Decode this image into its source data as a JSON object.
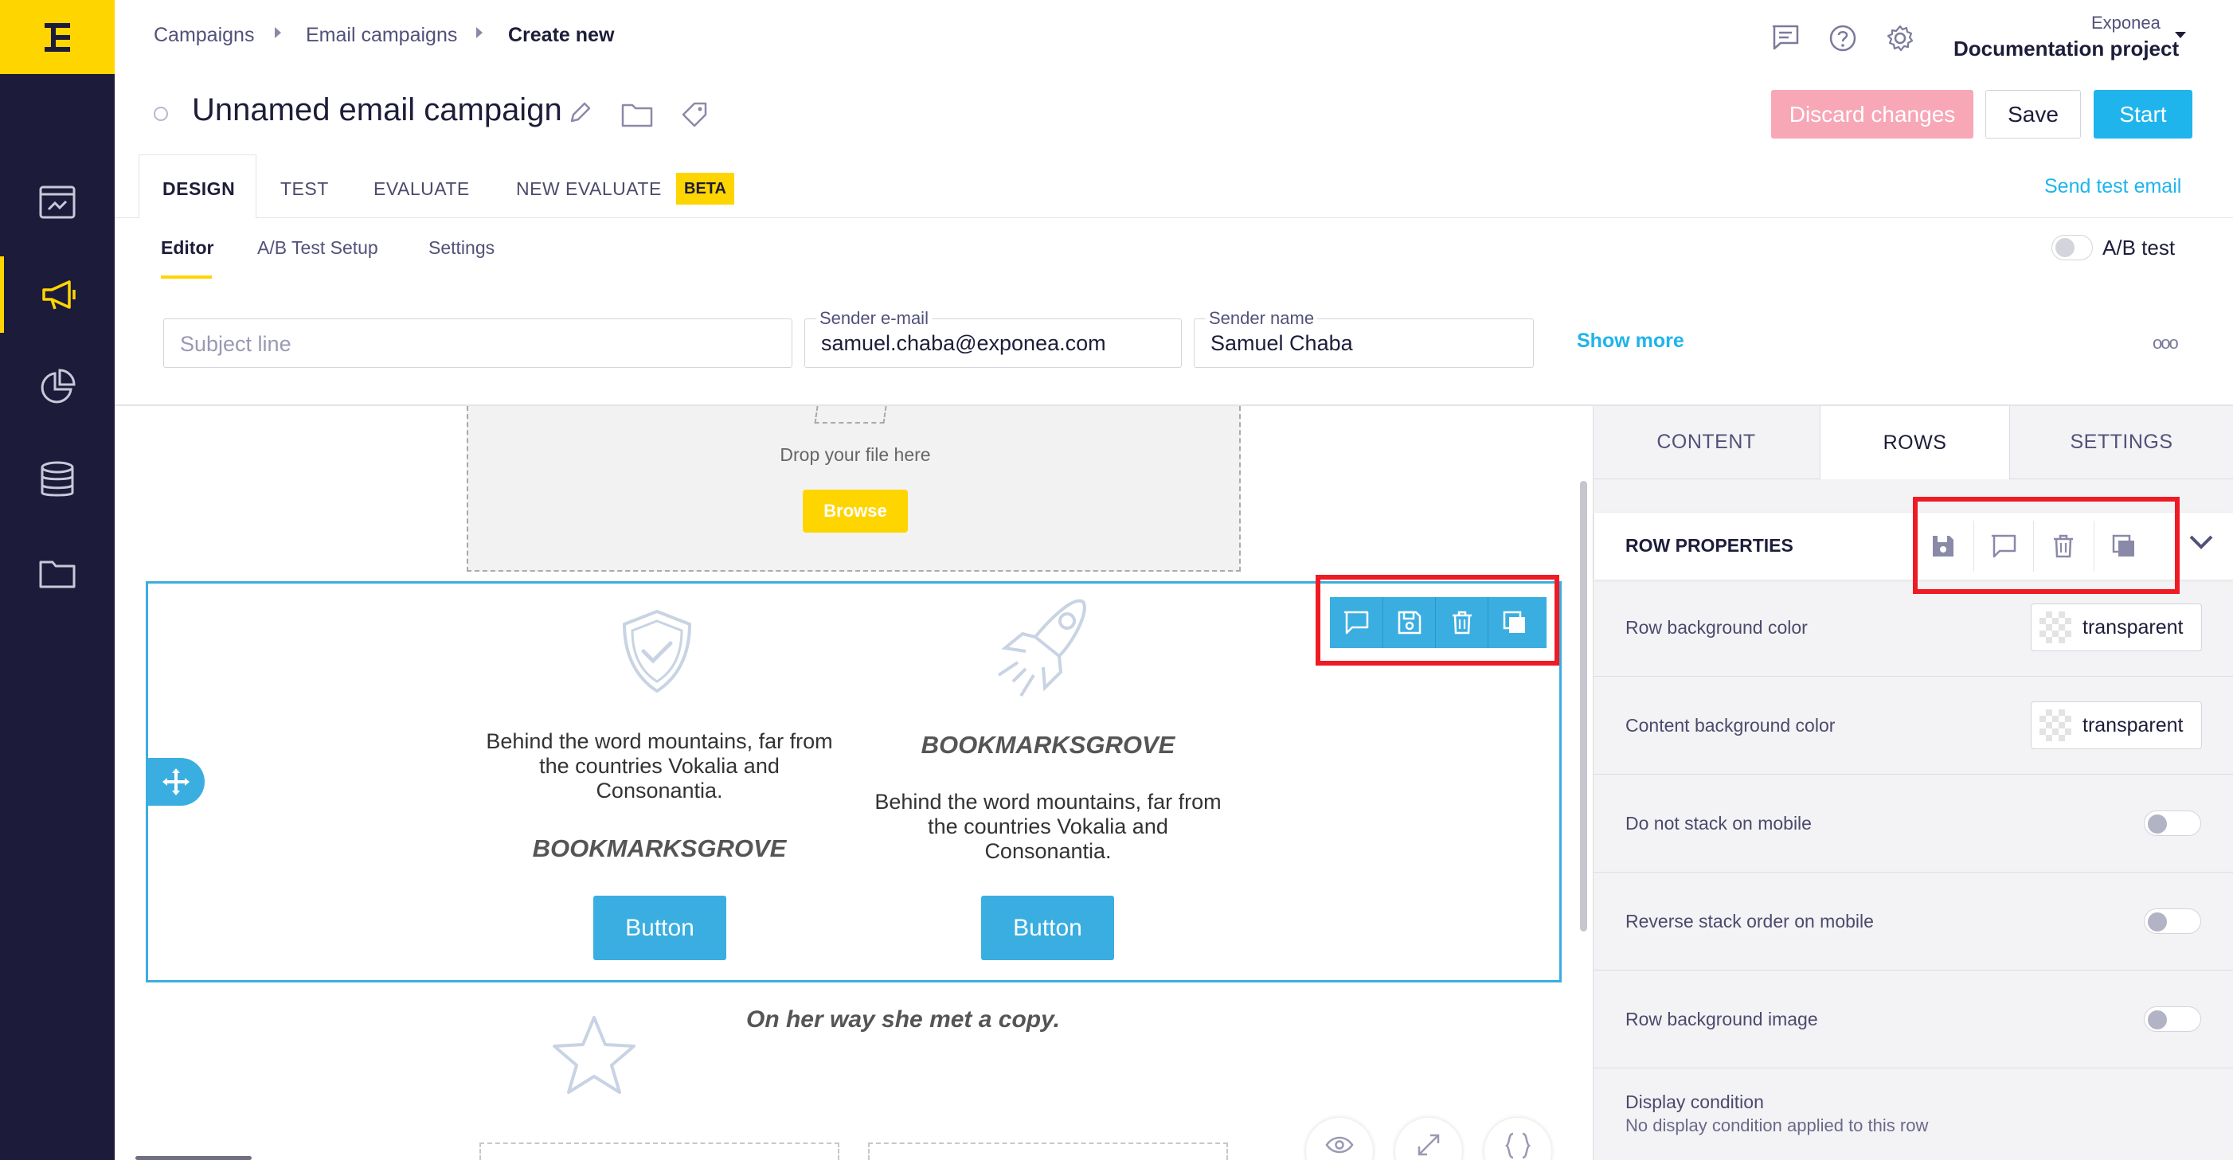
{
  "nav": {
    "icons": [
      "dashboard-icon",
      "campaigns-icon",
      "analytics-icon",
      "data-icon",
      "folder-icon"
    ]
  },
  "breadcrumb": {
    "items": [
      "Campaigns",
      "Email campaigns",
      "Create new"
    ]
  },
  "project": {
    "org": "Exponea",
    "name": "Documentation project"
  },
  "campaign": {
    "title": "Unnamed email campaign"
  },
  "actions": {
    "discard": "Discard changes",
    "save": "Save",
    "start": "Start"
  },
  "tabs": {
    "design": "DESIGN",
    "test": "TEST",
    "evaluate": "EVALUATE",
    "new_evaluate": "NEW EVALUATE",
    "beta": "BETA",
    "send_test": "Send test email"
  },
  "subtabs": {
    "editor": "Editor",
    "ab_setup": "A/B Test Setup",
    "settings": "Settings",
    "ab_test": "A/B test"
  },
  "fields": {
    "subject_placeholder": "Subject line",
    "sender_email_label": "Sender e-mail",
    "sender_email": "samuel.chaba@exponea.com",
    "sender_name_label": "Sender name",
    "sender_name": "Samuel Chaba",
    "show_more": "Show more",
    "more": "ooo"
  },
  "editor": {
    "drop_text": "Drop your file here",
    "browse": "Browse",
    "col1_text_1": "Behind the word mountains, far from",
    "col1_text_2": "the countries Vokalia and",
    "col1_text_3": "Consonantia.",
    "col1_heading": "BOOKMARKSGROVE",
    "col1_button": "Button",
    "col2_heading": "BOOKMARKSGROVE",
    "col2_text_1": "Behind the word mountains, far from",
    "col2_text_2": "the countries Vokalia and",
    "col2_text_3": "Consonantia.",
    "col2_button": "Button",
    "below_text": "On her way she met a copy."
  },
  "panel": {
    "tabs": [
      "CONTENT",
      "ROWS",
      "SETTINGS"
    ],
    "active_tab": "ROWS",
    "section_title": "ROW PROPERTIES",
    "row_bg_label": "Row background color",
    "row_bg_value": "transparent",
    "content_bg_label": "Content background color",
    "content_bg_value": "transparent",
    "no_stack_label": "Do not stack on mobile",
    "reverse_label": "Reverse stack order on mobile",
    "bg_image_label": "Row background image",
    "display_label": "Display condition",
    "display_desc": "No display condition applied to this row"
  },
  "colors": {
    "brand_yellow": "#ffd500",
    "nav_bg": "#1c1b39",
    "accent_blue": "#1fb4ec",
    "discard_pink": "#f7a7b6",
    "highlight_red": "#ee1b24"
  }
}
